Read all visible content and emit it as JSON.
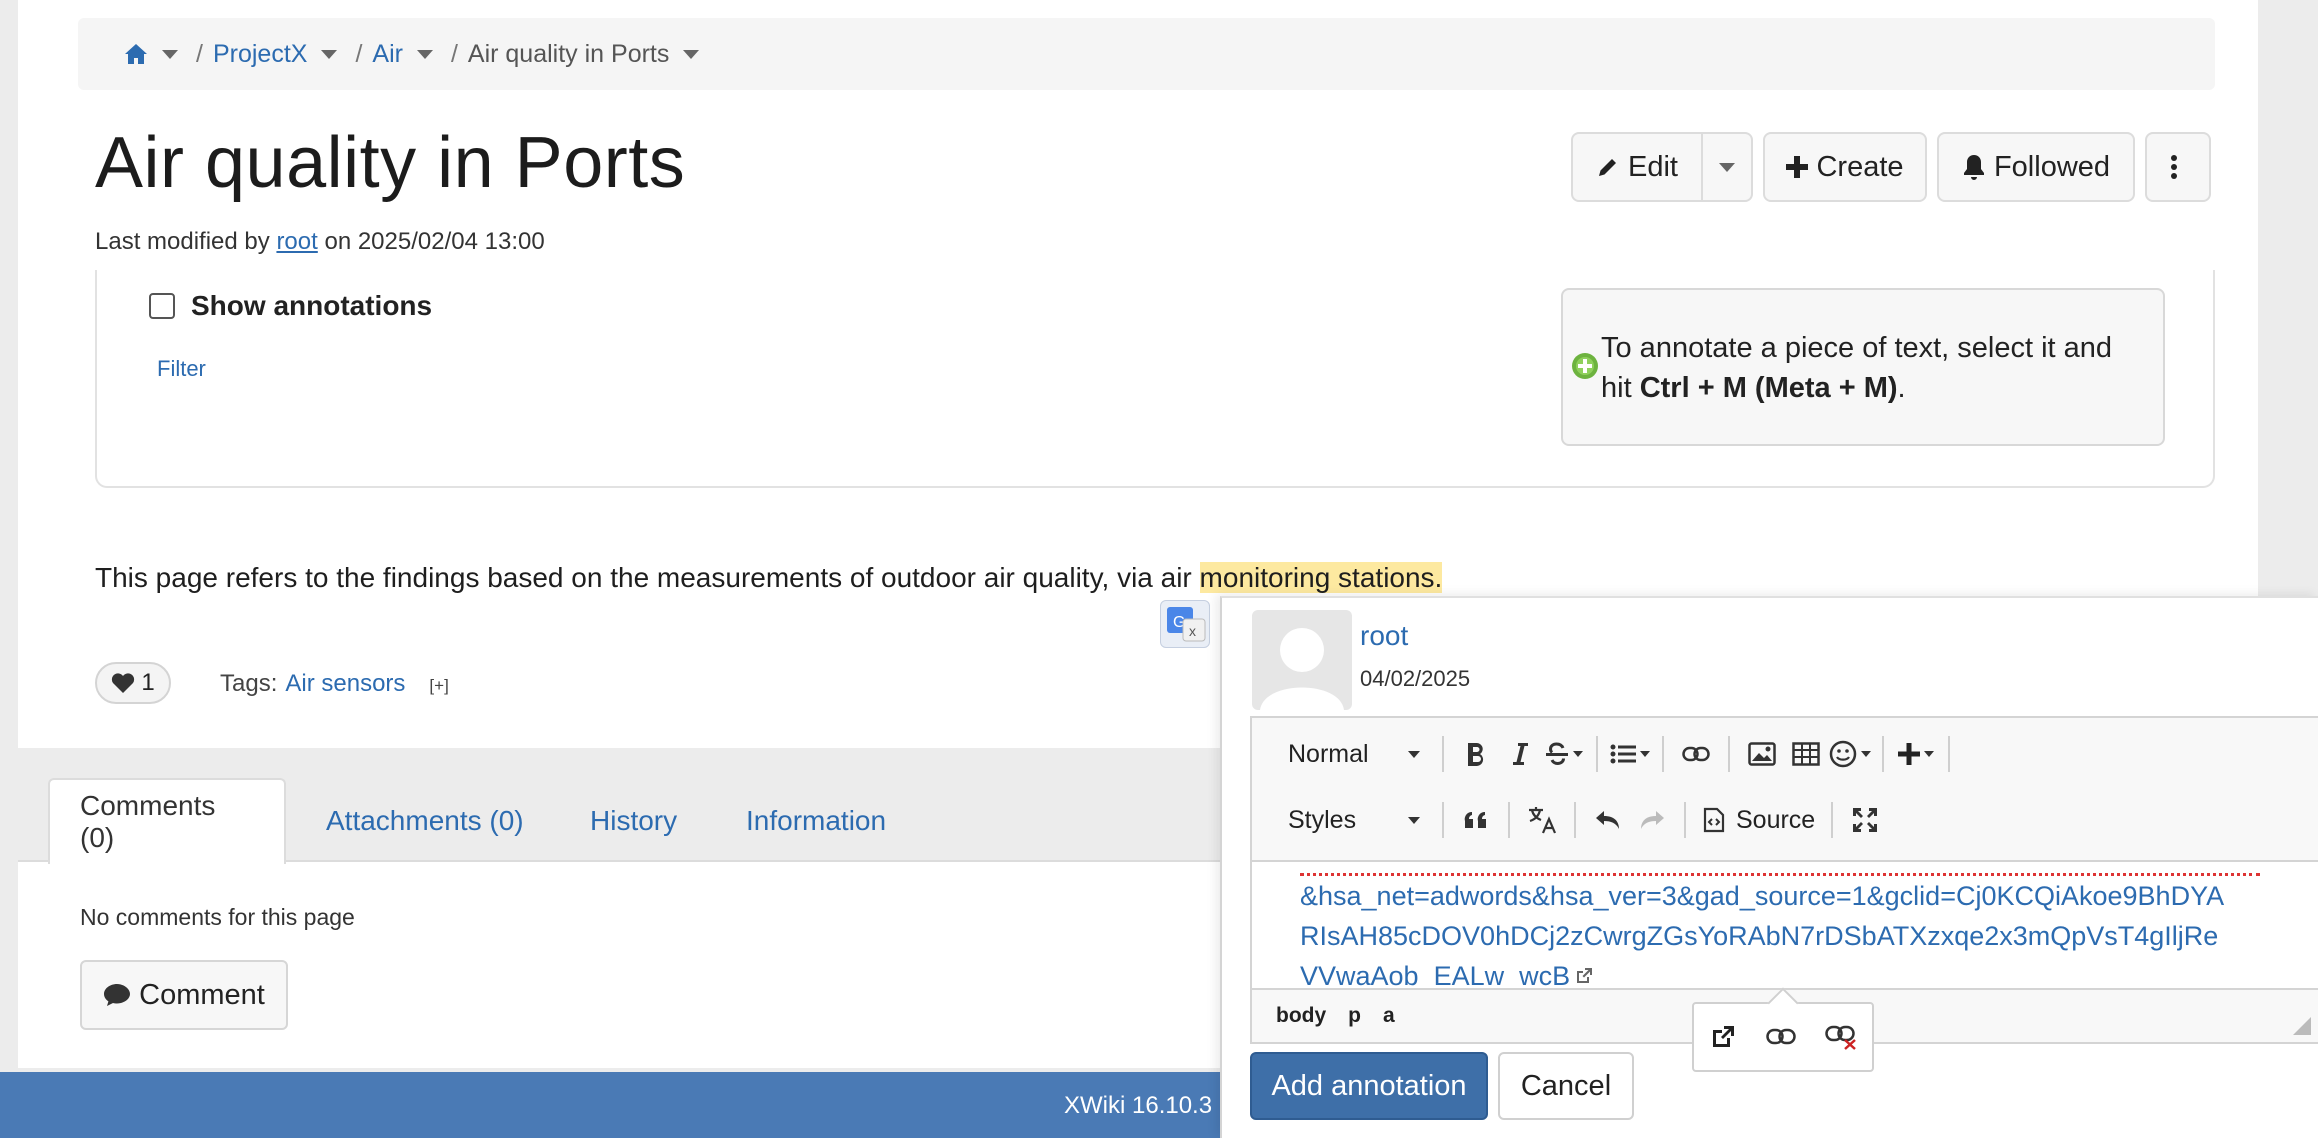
{
  "breadcrumb": {
    "home_icon": "home-icon",
    "items": [
      "ProjectX",
      "Air"
    ],
    "current": "Air quality in Ports",
    "separator": "/"
  },
  "page": {
    "title": "Air quality in Ports",
    "last_modified_prefix": "Last modified by",
    "last_modified_user": "root",
    "last_modified_on": "on 2025/02/04 13:00"
  },
  "actions": {
    "edit": "Edit",
    "create": "Create",
    "followed": "Followed"
  },
  "annotations": {
    "show_label": "Show annotations",
    "filter_label": "Filter",
    "help_text_1": "To annotate a piece of text, select it and hit",
    "help_shortcut": "Ctrl + M (Meta + M)",
    "help_text_2": "."
  },
  "content": {
    "paragraph_start": "This page refers to the findings based on the measurements of outdoor air quality, via air",
    "paragraph_highlight": "monitoring stations."
  },
  "likes": {
    "count": "1"
  },
  "tags": {
    "label": "Tags:",
    "items": [
      "Air sensors"
    ],
    "add": "[+]"
  },
  "tabs": [
    {
      "label": "Comments (0)",
      "active": true
    },
    {
      "label": "Attachments (0)"
    },
    {
      "label": "History"
    },
    {
      "label": "Information"
    }
  ],
  "comments": {
    "empty_text": "No comments for this page",
    "comment_button": "Comment"
  },
  "footer": {
    "version": "XWiki 16.10.3"
  },
  "annotation_form": {
    "author": "root",
    "date": "04/02/2025",
    "toolbar": {
      "format": "Normal",
      "styles": "Styles",
      "source": "Source"
    },
    "editor_lines": [
      "&hsa_net=adwords&hsa_ver=3&gad_source=1&gclid=Cj0KCQiAkoe9BhDYA",
      "RIsAH85cDOV0hDCj2zCwrgZGsYoRAbN7rDSbATXzxqe2x3mQpVsT4gIljRe",
      "VVwaAob_EALw_wcB"
    ],
    "path": [
      "body",
      "p",
      "a"
    ],
    "add_button": "Add annotation",
    "cancel_button": "Cancel"
  },
  "colors": {
    "link": "#2c6bb0",
    "footer": "#4a7ab5",
    "primary_button": "#3e6fa8",
    "highlight": "#fde9a0"
  }
}
